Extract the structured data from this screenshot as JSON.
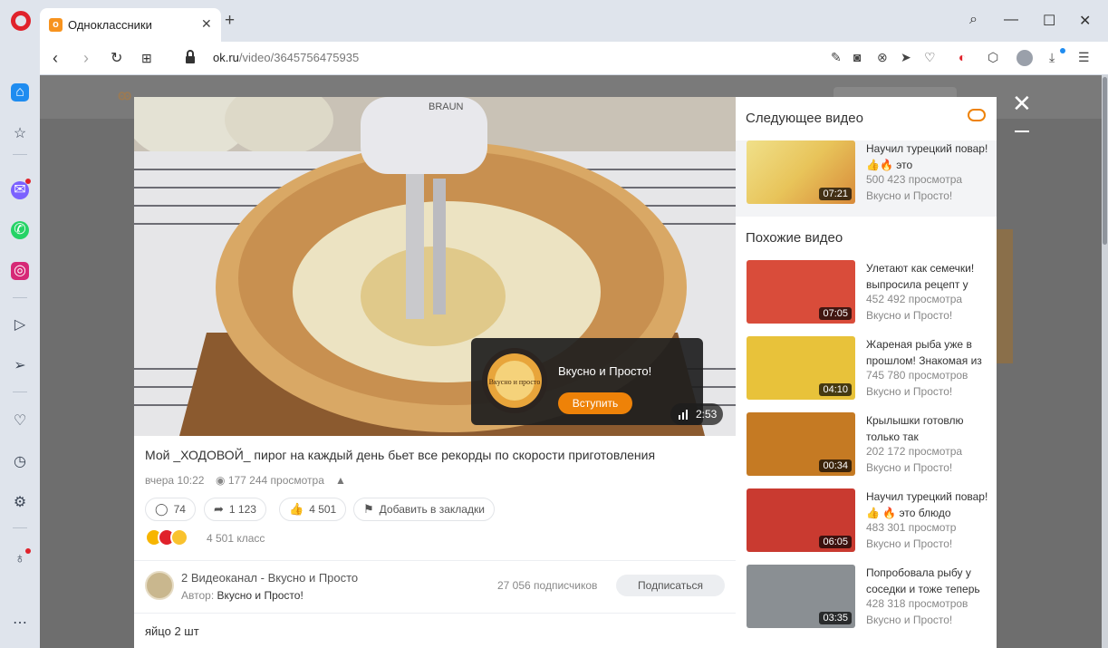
{
  "browser": {
    "tab_title": "Одноклассники",
    "tab_favicon": "ok",
    "url_host": "ok.ru",
    "url_path": "/video/3645756475935"
  },
  "sidebar_icons": [
    "home-icon",
    "star-icon",
    "messenger-icon",
    "whatsapp-icon",
    "instagram-icon",
    "player-icon",
    "send-icon",
    "heart-icon",
    "history-icon",
    "settings-icon",
    "lightbulb-icon",
    "more-icon"
  ],
  "player": {
    "channel_popup_name": "Вкусно и Просто!",
    "join_label": "Вступить",
    "logo_text": "Вкусно и просто",
    "duration": "2:53",
    "mixer_brand": "BRAUN"
  },
  "video": {
    "title": "Мой _ХОДОВОЙ_ пирог на каждый день бьет все рекорды по скорости приготовления",
    "time": "вчера 10:22",
    "views": "177 244 просмотра",
    "comments": "74",
    "shares": "1 123",
    "likes": "4 501",
    "bookmark_label": "Добавить в закладки",
    "reactions_count": "4 501 класс"
  },
  "channel": {
    "title": "2 Видеоканал - Вкусно и Просто",
    "author_label": "Автор:",
    "author_name": "Вкусно и Просто!",
    "subscribers": "27 056 подписчиков",
    "subscribe_label": "Подписаться"
  },
  "description": "яйцо 2 шт",
  "next_video": {
    "heading": "Следующее видео",
    "title": "Научил турецкий повар! 👍🔥 это",
    "views": "500 423 просмотра",
    "channel": "Вкусно и Просто!",
    "duration": "07:21"
  },
  "similar": {
    "heading": "Похожие видео",
    "items": [
      {
        "title": "Улетают как семечки! выпросила рецепт у",
        "views": "452 492 просмотра",
        "channel": "Вкусно и Просто!",
        "duration": "07:05",
        "color": "#d94c3a"
      },
      {
        "title": "Жареная рыба уже в прошлом! Знакомая из",
        "views": "745 780 просмотров",
        "channel": "Вкусно и Просто!",
        "duration": "04:10",
        "color": "#e8c23a"
      },
      {
        "title": "Крылышки готовлю только так",
        "views": "202 172 просмотра",
        "channel": "Вкусно и Просто!",
        "duration": "00:34",
        "color": "#c57a23"
      },
      {
        "title": "Научил турецкий повар! 👍 🔥 это блюдо",
        "views": "483 301 просмотр",
        "channel": "Вкусно и Просто!",
        "duration": "06:05",
        "color": "#c93a30"
      },
      {
        "title": "Попробовала рыбу у соседки и тоже теперь",
        "views": "428 318 просмотров",
        "channel": "Вкусно и Просто!",
        "duration": "03:35",
        "color": "#8a8f93"
      }
    ]
  }
}
